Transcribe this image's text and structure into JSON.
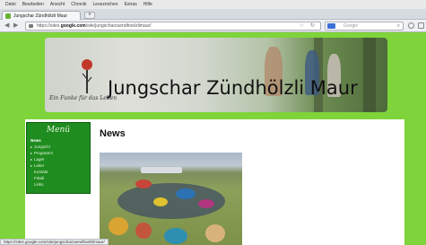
{
  "browser": {
    "menu": [
      "Datei",
      "Bearbeiten",
      "Ansicht",
      "Chronik",
      "Lesezeichen",
      "Extras",
      "Hilfe"
    ],
    "tab_title": "Jungschar Zündhölzli Maur",
    "new_tab": "+",
    "url_prefix": "https://sites.",
    "url_domain": "google.com",
    "url_suffix": "/site/jungscharzuendhoelzlimaur/",
    "search_placeholder": "Google",
    "back": "◀",
    "forward": "▶",
    "star": "☆",
    "reload": "↻",
    "search_go": "⌕"
  },
  "header": {
    "title": "Jungschar Zündhölzli Maur",
    "motto": "Ein Funke für das Leben"
  },
  "sidebar": {
    "title": "Menü",
    "items": [
      {
        "label": "News",
        "active": true
      },
      {
        "label": "Jungschi",
        "active": false
      },
      {
        "label": "Programm",
        "active": false
      },
      {
        "label": "Lager",
        "active": false
      },
      {
        "label": "Leiter",
        "active": false
      },
      {
        "label": "Kontakt",
        "active": false
      },
      {
        "label": "Fötali",
        "active": false
      },
      {
        "label": "Links",
        "active": false
      }
    ]
  },
  "main": {
    "heading": "News"
  },
  "status": {
    "url": "https://sites.google.com/site/jungscharzuendhoelzlimaur/"
  },
  "colors": {
    "page_background": "#7ed43a",
    "sidebar": "#1f8c1f"
  }
}
